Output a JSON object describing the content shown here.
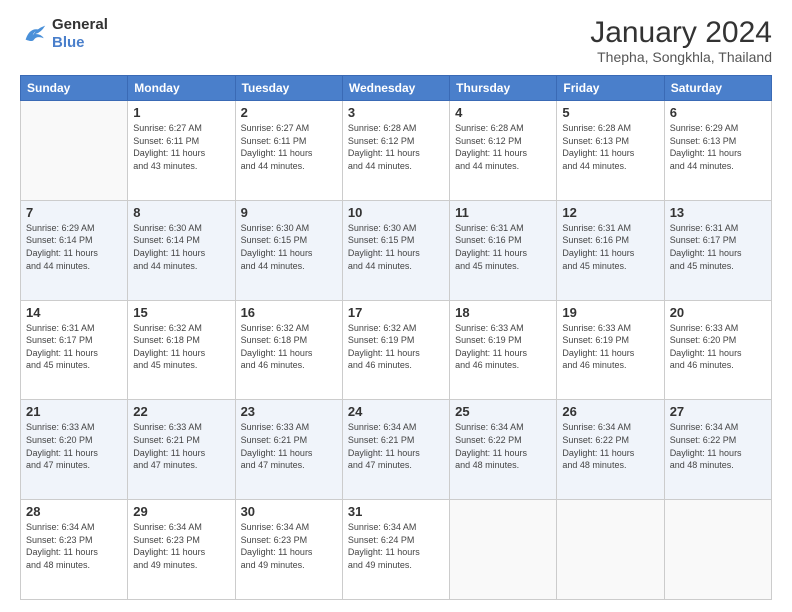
{
  "logo": {
    "line1": "General",
    "line2": "Blue"
  },
  "title": "January 2024",
  "subtitle": "Thepha, Songkhla, Thailand",
  "days_of_week": [
    "Sunday",
    "Monday",
    "Tuesday",
    "Wednesday",
    "Thursday",
    "Friday",
    "Saturday"
  ],
  "weeks": [
    [
      {
        "day": "",
        "info": ""
      },
      {
        "day": "1",
        "info": "Sunrise: 6:27 AM\nSunset: 6:11 PM\nDaylight: 11 hours\nand 43 minutes."
      },
      {
        "day": "2",
        "info": "Sunrise: 6:27 AM\nSunset: 6:11 PM\nDaylight: 11 hours\nand 44 minutes."
      },
      {
        "day": "3",
        "info": "Sunrise: 6:28 AM\nSunset: 6:12 PM\nDaylight: 11 hours\nand 44 minutes."
      },
      {
        "day": "4",
        "info": "Sunrise: 6:28 AM\nSunset: 6:12 PM\nDaylight: 11 hours\nand 44 minutes."
      },
      {
        "day": "5",
        "info": "Sunrise: 6:28 AM\nSunset: 6:13 PM\nDaylight: 11 hours\nand 44 minutes."
      },
      {
        "day": "6",
        "info": "Sunrise: 6:29 AM\nSunset: 6:13 PM\nDaylight: 11 hours\nand 44 minutes."
      }
    ],
    [
      {
        "day": "7",
        "info": "Sunrise: 6:29 AM\nSunset: 6:14 PM\nDaylight: 11 hours\nand 44 minutes."
      },
      {
        "day": "8",
        "info": "Sunrise: 6:30 AM\nSunset: 6:14 PM\nDaylight: 11 hours\nand 44 minutes."
      },
      {
        "day": "9",
        "info": "Sunrise: 6:30 AM\nSunset: 6:15 PM\nDaylight: 11 hours\nand 44 minutes."
      },
      {
        "day": "10",
        "info": "Sunrise: 6:30 AM\nSunset: 6:15 PM\nDaylight: 11 hours\nand 44 minutes."
      },
      {
        "day": "11",
        "info": "Sunrise: 6:31 AM\nSunset: 6:16 PM\nDaylight: 11 hours\nand 45 minutes."
      },
      {
        "day": "12",
        "info": "Sunrise: 6:31 AM\nSunset: 6:16 PM\nDaylight: 11 hours\nand 45 minutes."
      },
      {
        "day": "13",
        "info": "Sunrise: 6:31 AM\nSunset: 6:17 PM\nDaylight: 11 hours\nand 45 minutes."
      }
    ],
    [
      {
        "day": "14",
        "info": "Sunrise: 6:31 AM\nSunset: 6:17 PM\nDaylight: 11 hours\nand 45 minutes."
      },
      {
        "day": "15",
        "info": "Sunrise: 6:32 AM\nSunset: 6:18 PM\nDaylight: 11 hours\nand 45 minutes."
      },
      {
        "day": "16",
        "info": "Sunrise: 6:32 AM\nSunset: 6:18 PM\nDaylight: 11 hours\nand 46 minutes."
      },
      {
        "day": "17",
        "info": "Sunrise: 6:32 AM\nSunset: 6:19 PM\nDaylight: 11 hours\nand 46 minutes."
      },
      {
        "day": "18",
        "info": "Sunrise: 6:33 AM\nSunset: 6:19 PM\nDaylight: 11 hours\nand 46 minutes."
      },
      {
        "day": "19",
        "info": "Sunrise: 6:33 AM\nSunset: 6:19 PM\nDaylight: 11 hours\nand 46 minutes."
      },
      {
        "day": "20",
        "info": "Sunrise: 6:33 AM\nSunset: 6:20 PM\nDaylight: 11 hours\nand 46 minutes."
      }
    ],
    [
      {
        "day": "21",
        "info": "Sunrise: 6:33 AM\nSunset: 6:20 PM\nDaylight: 11 hours\nand 47 minutes."
      },
      {
        "day": "22",
        "info": "Sunrise: 6:33 AM\nSunset: 6:21 PM\nDaylight: 11 hours\nand 47 minutes."
      },
      {
        "day": "23",
        "info": "Sunrise: 6:33 AM\nSunset: 6:21 PM\nDaylight: 11 hours\nand 47 minutes."
      },
      {
        "day": "24",
        "info": "Sunrise: 6:34 AM\nSunset: 6:21 PM\nDaylight: 11 hours\nand 47 minutes."
      },
      {
        "day": "25",
        "info": "Sunrise: 6:34 AM\nSunset: 6:22 PM\nDaylight: 11 hours\nand 48 minutes."
      },
      {
        "day": "26",
        "info": "Sunrise: 6:34 AM\nSunset: 6:22 PM\nDaylight: 11 hours\nand 48 minutes."
      },
      {
        "day": "27",
        "info": "Sunrise: 6:34 AM\nSunset: 6:22 PM\nDaylight: 11 hours\nand 48 minutes."
      }
    ],
    [
      {
        "day": "28",
        "info": "Sunrise: 6:34 AM\nSunset: 6:23 PM\nDaylight: 11 hours\nand 48 minutes."
      },
      {
        "day": "29",
        "info": "Sunrise: 6:34 AM\nSunset: 6:23 PM\nDaylight: 11 hours\nand 49 minutes."
      },
      {
        "day": "30",
        "info": "Sunrise: 6:34 AM\nSunset: 6:23 PM\nDaylight: 11 hours\nand 49 minutes."
      },
      {
        "day": "31",
        "info": "Sunrise: 6:34 AM\nSunset: 6:24 PM\nDaylight: 11 hours\nand 49 minutes."
      },
      {
        "day": "",
        "info": ""
      },
      {
        "day": "",
        "info": ""
      },
      {
        "day": "",
        "info": ""
      }
    ]
  ]
}
